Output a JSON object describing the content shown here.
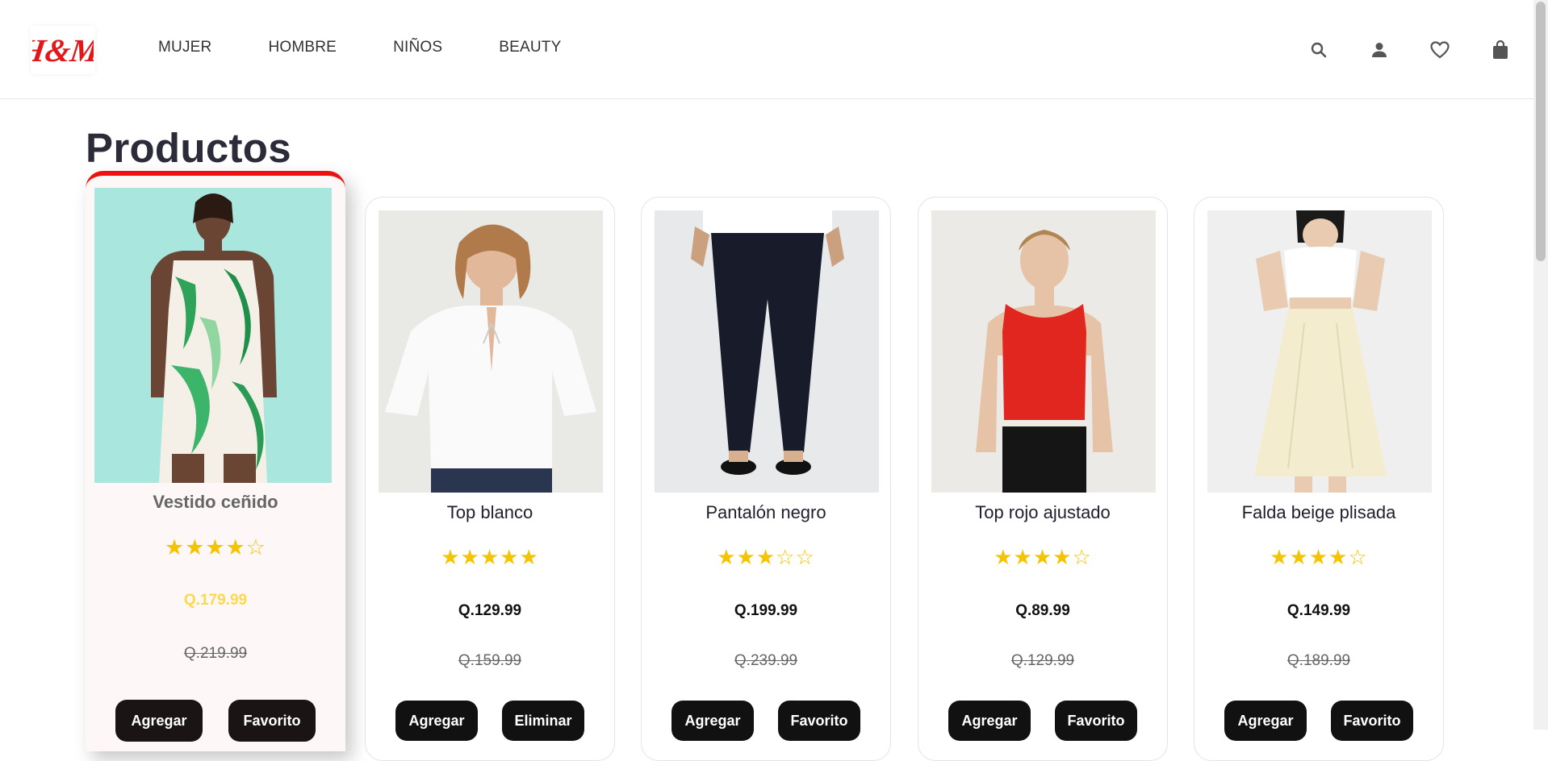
{
  "header": {
    "logo_text": "H&M",
    "nav": [
      "MUJER",
      "HOMBRE",
      "NIÑOS",
      "BEAUTY"
    ]
  },
  "icons": [
    "search-icon",
    "user-icon",
    "heart-icon",
    "shopping-bag-icon"
  ],
  "page_title": "Productos",
  "colors": {
    "brand_red": "#e3161a",
    "star_yellow": "#f5c400",
    "button_black": "#111111",
    "featured_price": "#ffd84a"
  },
  "products": [
    {
      "name": "Vestido ceñido",
      "stars": "★★★★☆",
      "rating": 4,
      "price": "Q.179.99",
      "old_price": "Q.219.99",
      "btn1": "Agregar",
      "btn2": "Favorito"
    },
    {
      "name": "Top blanco",
      "stars": "★★★★★",
      "rating": 5,
      "price": "Q.129.99",
      "old_price": "Q.159.99",
      "btn1": "Agregar",
      "btn2": "Eliminar"
    },
    {
      "name": "Pantalón negro",
      "stars": "★★★☆☆",
      "rating": 3,
      "price": "Q.199.99",
      "old_price": "Q.239.99",
      "btn1": "Agregar",
      "btn2": "Favorito"
    },
    {
      "name": "Top rojo ajustado",
      "stars": "★★★★☆",
      "rating": 4,
      "price": "Q.89.99",
      "old_price": "Q.129.99",
      "btn1": "Agregar",
      "btn2": "Favorito"
    },
    {
      "name": "Falda beige plisada",
      "stars": "★★★★☆",
      "rating": 4,
      "price": "Q.149.99",
      "old_price": "Q.189.99",
      "btn1": "Agregar",
      "btn2": "Favorito"
    }
  ]
}
